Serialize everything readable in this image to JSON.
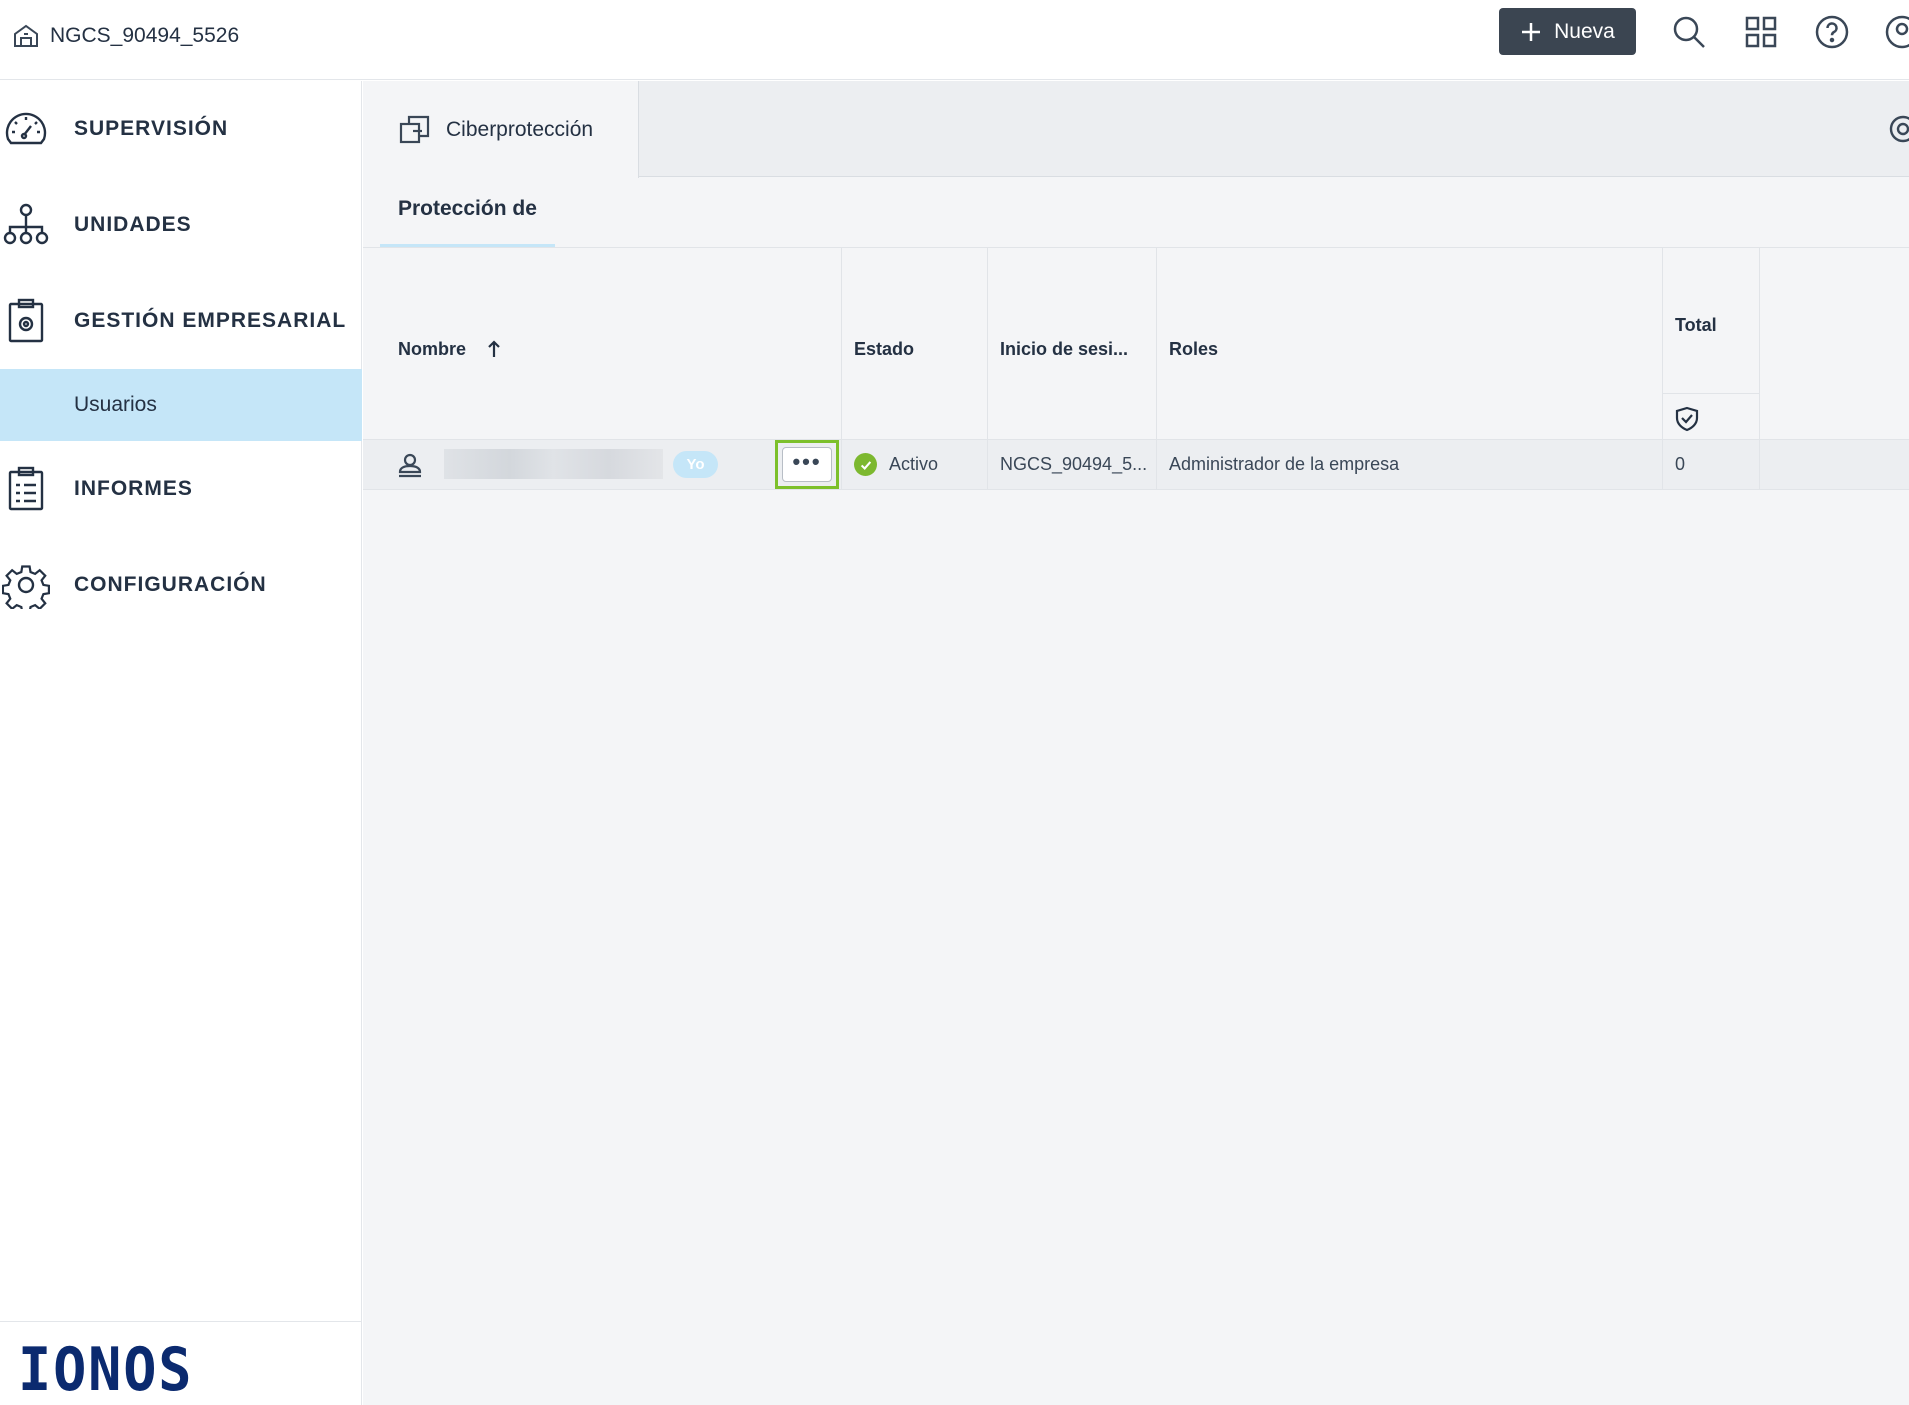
{
  "topbar": {
    "tenant_name": "NGCS_90494_5526",
    "new_button_label": "Nueva",
    "icons": [
      "search-icon",
      "apps-grid-icon",
      "help-icon",
      "account-icon"
    ]
  },
  "sidebar": {
    "items": [
      {
        "label": "SUPERVISIÓN",
        "icon": "dashboard-gauge-icon"
      },
      {
        "label": "UNIDADES",
        "icon": "org-tree-icon"
      },
      {
        "label": "GESTIÓN EMPRESARIAL",
        "icon": "clipboard-gear-icon"
      },
      {
        "label": "INFORMES",
        "icon": "report-list-icon"
      },
      {
        "label": "CONFIGURACIÓN",
        "icon": "gear-icon"
      }
    ],
    "active_sub_item": "Usuarios",
    "logo_text": "IONOS"
  },
  "main": {
    "tab_label": "Ciberprotección",
    "subtab_label": "Protección de",
    "table": {
      "headers": {
        "name": "Nombre",
        "status": "Estado",
        "login": "Inicio de sesi...",
        "roles": "Roles",
        "total": "Total"
      },
      "sort": "ascending",
      "rows": [
        {
          "me_badge": "Yo",
          "more_label": "•••",
          "status": "Activo",
          "login": "NGCS_90494_5...",
          "roles": "Administrador de la empresa",
          "total": "0"
        }
      ]
    }
  },
  "colors": {
    "accent_light_blue": "#c5e6f8",
    "dark_button": "#3b4551",
    "status_green": "#7cb82f",
    "highlight_green": "#7cc02b",
    "logo_blue": "#0b2a6f"
  }
}
